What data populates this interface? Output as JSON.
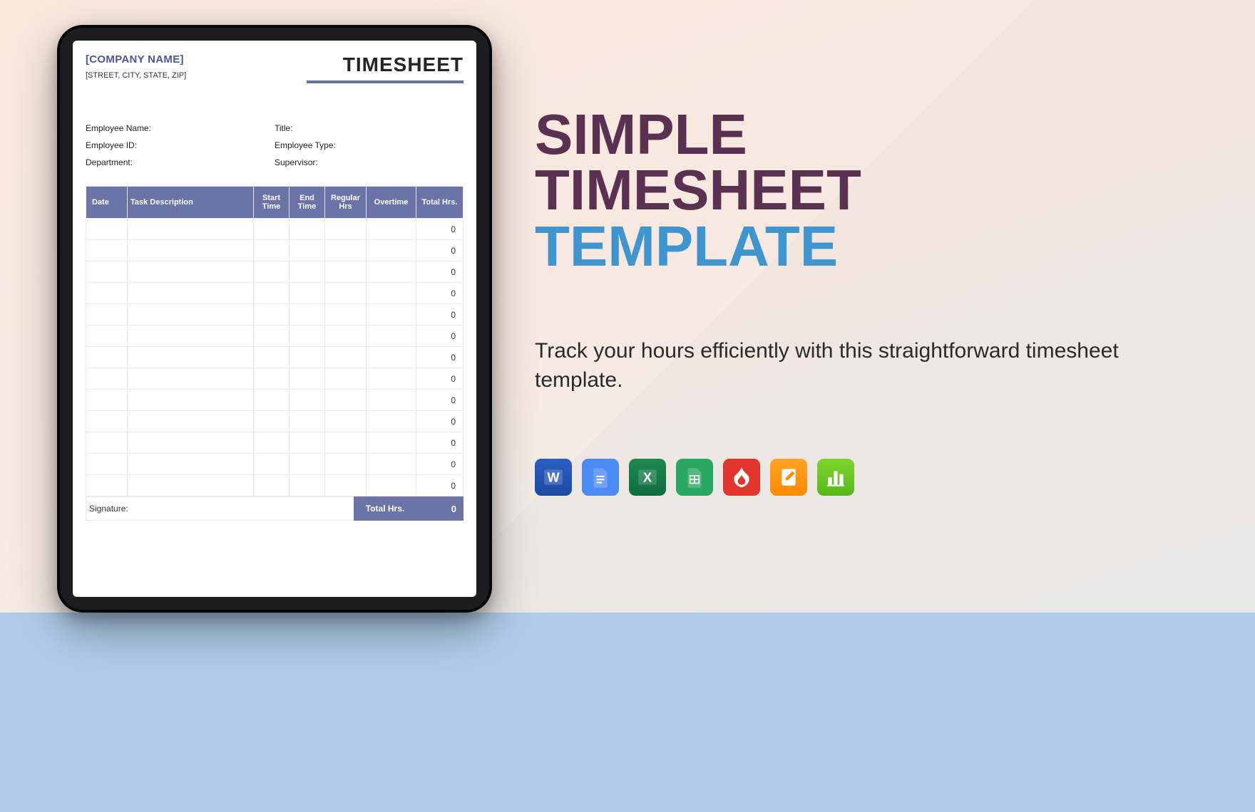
{
  "document": {
    "company_placeholder": "[COMPANY NAME]",
    "address_placeholder": "[STREET, CITY, STATE, ZIP]",
    "title": "TIMESHEET",
    "fields": {
      "employee_name": "Employee Name:",
      "title": "Title:",
      "employee_id": "Employee ID:",
      "employee_type": "Employee Type:",
      "department": "Department:",
      "supervisor": "Supervisor:"
    },
    "columns": {
      "date": "Date",
      "task": "Task Description",
      "start": "Start Time",
      "end": "End Time",
      "regular": "Regular Hrs",
      "overtime": "Overtime",
      "total": "Total Hrs."
    },
    "rows": [
      {
        "total": "0"
      },
      {
        "total": "0"
      },
      {
        "total": "0"
      },
      {
        "total": "0"
      },
      {
        "total": "0"
      },
      {
        "total": "0"
      },
      {
        "total": "0"
      },
      {
        "total": "0"
      },
      {
        "total": "0"
      },
      {
        "total": "0"
      },
      {
        "total": "0"
      },
      {
        "total": "0"
      },
      {
        "total": "0"
      }
    ],
    "signature_label": "Signature:",
    "total_label": "Total Hrs.",
    "total_value": "0"
  },
  "promo": {
    "heading_l1": "SIMPLE",
    "heading_l2": "TIMESHEET",
    "heading_l3": "TEMPLATE",
    "subtext": "Track your hours efficiently with this straightforward timesheet template."
  },
  "apps": {
    "word": "Microsoft Word",
    "gdoc": "Google Docs",
    "excel": "Microsoft Excel",
    "gsheet": "Google Sheets",
    "pdf": "PDF",
    "pages": "Apple Pages",
    "numbers": "Apple Numbers"
  },
  "colors": {
    "brand_purple": "#5b3151",
    "brand_blue": "#3e95cf",
    "table_header": "#6b74a7"
  }
}
